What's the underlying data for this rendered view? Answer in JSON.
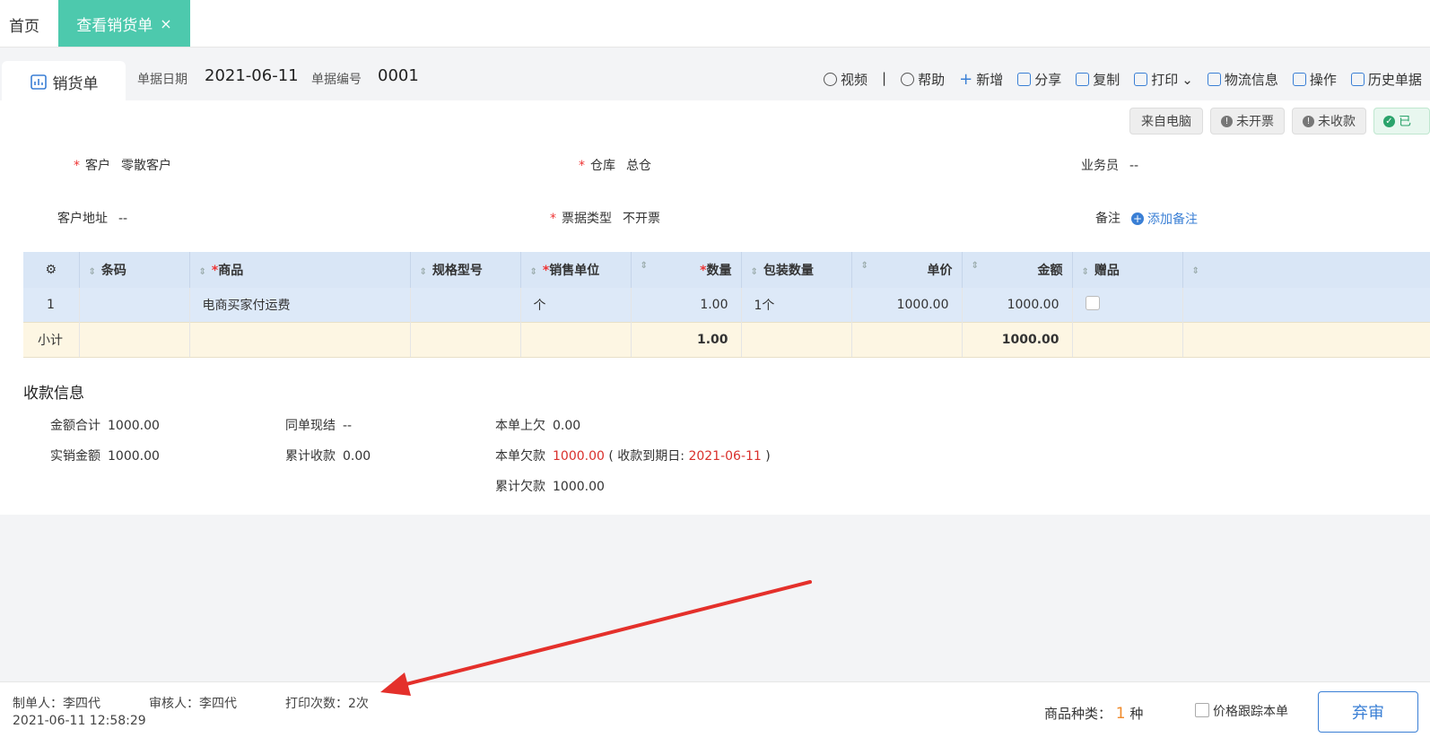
{
  "top_tabs": {
    "home": "首页",
    "active": "查看销货单",
    "close_icon": "×"
  },
  "header": {
    "doc_title": "销货单",
    "date_label": "单据日期",
    "date_value": "2021-06-11",
    "no_label": "单据编号",
    "no_value": "0001",
    "toolbar": {
      "video": "视频",
      "sep": "|",
      "help": "帮助",
      "add": "新增",
      "share": "分享",
      "copy": "复制",
      "print": "打印",
      "logistics": "物流信息",
      "ops": "操作",
      "history": "历史单据"
    }
  },
  "status_chips": {
    "source": "来自电脑",
    "invoice": "未开票",
    "receipt": "未收款",
    "audit": "已"
  },
  "form": {
    "customer_label": "客户",
    "customer_value": "零散客户",
    "warehouse_label": "仓库",
    "warehouse_value": "总仓",
    "salesman_label": "业务员",
    "salesman_value": "--",
    "address_label": "客户地址",
    "address_value": "--",
    "bill_type_label": "票据类型",
    "bill_type_value": "不开票",
    "note_label": "备注",
    "add_note": "添加备注",
    "required_mark": "*"
  },
  "table": {
    "headers": {
      "barcode": "条码",
      "product": "商品",
      "spec": "规格型号",
      "unit": "销售单位",
      "qty": "数量",
      "pack": "包装数量",
      "price": "单价",
      "amount": "金额",
      "gift": "赠品"
    },
    "rows": [
      {
        "idx": "1",
        "barcode": "",
        "product": "电商买家付运费",
        "spec": "",
        "unit": "个",
        "qty": "1.00",
        "pack": "1个",
        "price": "1000.00",
        "amount": "1000.00"
      }
    ],
    "subtotal": {
      "label": "小计",
      "qty": "1.00",
      "amount": "1000.00"
    }
  },
  "payment": {
    "title": "收款信息",
    "total_label": "金额合计",
    "total_value": "1000.00",
    "actual_label": "实销金额",
    "actual_value": "1000.00",
    "cash_label": "同单现结",
    "cash_value": "--",
    "cum_recv_label": "累计收款",
    "cum_recv_value": "0.00",
    "prev_owe_label": "本单上欠",
    "prev_owe_value": "0.00",
    "owe_label": "本单欠款",
    "owe_value": "1000.00",
    "due_prefix": "( 收款到期日:",
    "due_value": "2021-06-11",
    "due_suffix": ")",
    "cum_owe_label": "累计欠款",
    "cum_owe_value": "1000.00"
  },
  "footer": {
    "maker": "制单人：李四代",
    "time": "2021-06-11 12:58:29",
    "auditor": "审核人：李四代",
    "print_count": "打印次数：2次",
    "kinds_label": "商品种类：",
    "kinds_value": "1",
    "kinds_unit": "种",
    "track_price": "价格跟踪本单",
    "unaudit": "弃审"
  },
  "colors": {
    "tab_green": "#4dc9ad",
    "table_header": "#d9e6f6",
    "accent_blue": "#3a7fd5",
    "arrow_red": "#e4302b"
  }
}
